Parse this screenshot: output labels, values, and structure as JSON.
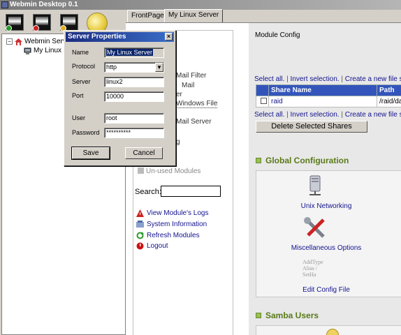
{
  "window": {
    "title": "Webmin Desktop 0.1"
  },
  "toolbar": {
    "icons": [
      "monitor-green-icon",
      "monitor-red-icon",
      "monitor-yellow-icon",
      "cd-icon"
    ]
  },
  "tree": {
    "toggle": "−",
    "root_label": "Webmin Servers",
    "child_label": "My Linux Server"
  },
  "tabs": [
    {
      "label": "FrontPage",
      "active": false
    },
    {
      "label": "My Linux Server",
      "active": true
    }
  ],
  "browser": {
    "module_config": "Module Config",
    "left_modules": [
      {
        "label": "Mail Filter",
        "disabled": false
      },
      {
        "label": "Mail",
        "disabled": false
      },
      {
        "label": "er",
        "disabled": false
      },
      {
        "label": "Windows File",
        "disabled": false
      },
      {
        "label": "Mail Server",
        "disabled": false
      },
      {
        "label": "g",
        "disabled": false
      },
      {
        "label": "Un-used Modules",
        "disabled": true
      }
    ],
    "search_label": "Search:",
    "actions": [
      {
        "label": "View Module's Logs",
        "icon": "warning-icon",
        "color": "#cc2222"
      },
      {
        "label": "System Information",
        "icon": "info-icon",
        "color": "#4a6aaa"
      },
      {
        "label": "Refresh Modules",
        "icon": "refresh-icon",
        "color": "#2a9a2a"
      },
      {
        "label": "Logout",
        "icon": "power-icon",
        "color": "#cc1111"
      }
    ],
    "select_links": {
      "select_all": "Select all.",
      "invert": "Invert selection.",
      "create": "Create a new file sh"
    },
    "shares_table": {
      "headers": [
        "Share Name",
        "Path"
      ],
      "rows": [
        {
          "name": "raid",
          "path": "/raid/da"
        }
      ]
    },
    "delete_button": "Delete Selected Shares",
    "global_config": {
      "title": "Global Configuration",
      "items": [
        {
          "label": "Unix Networking",
          "icon": "network-icon"
        },
        {
          "label": "Miscellaneous Options",
          "icon": "tools-icon"
        },
        {
          "label": "Edit Config File",
          "icon": "edit-config-icon",
          "icon_text": [
            "AddType",
            "Alias /",
            "SetHa"
          ]
        }
      ]
    },
    "samba_users": {
      "title": "Samba Users"
    }
  },
  "dialog": {
    "title": "Server Properties",
    "close": "×",
    "fields": {
      "name": {
        "label": "Name",
        "value": "My Linux Server"
      },
      "protocol": {
        "label": "Protocol",
        "value": "http"
      },
      "server": {
        "label": "Server",
        "value": "linux2"
      },
      "port": {
        "label": "Port",
        "value": "10000"
      },
      "user": {
        "label": "User",
        "value": "root"
      },
      "password": {
        "label": "Password",
        "value": "**********"
      }
    },
    "save_button": "Save",
    "cancel_button": "Cancel"
  }
}
